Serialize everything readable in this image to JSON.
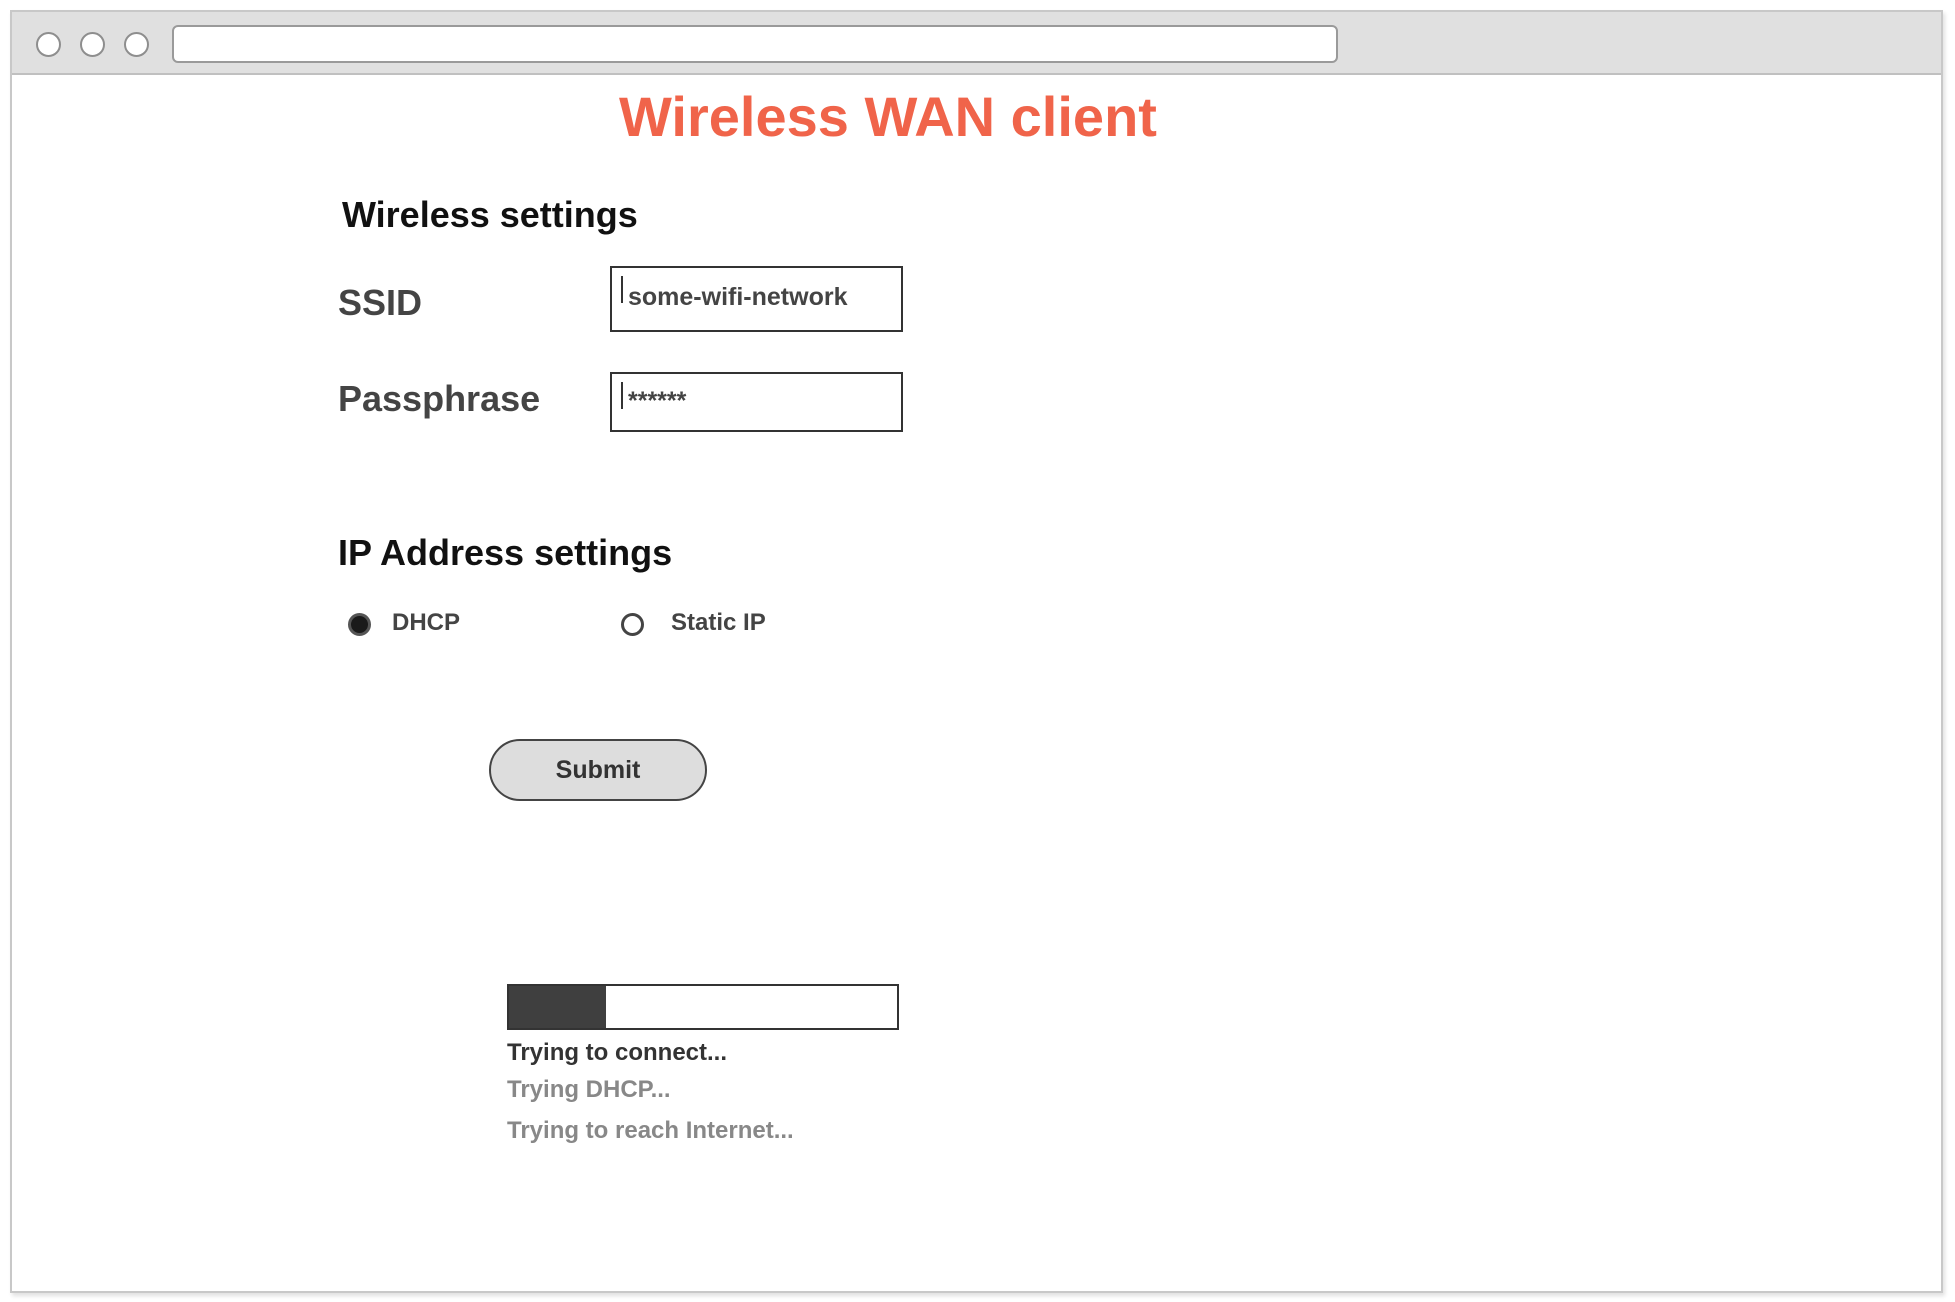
{
  "window": {
    "address_bar_value": ""
  },
  "page": {
    "title": "Wireless WAN client",
    "title_color": "#f0644a"
  },
  "wireless": {
    "heading": "Wireless settings",
    "ssid_label": "SSID",
    "ssid_value": "some-wifi-network",
    "passphrase_label": "Passphrase",
    "passphrase_value": "******"
  },
  "ip": {
    "heading": "IP Address settings",
    "options": [
      {
        "label": "DHCP",
        "selected": true
      },
      {
        "label": "Static IP",
        "selected": false
      }
    ]
  },
  "actions": {
    "submit_label": "Submit"
  },
  "progress": {
    "value_percent": 25,
    "fill_color": "#3f3f3f",
    "status": [
      {
        "text": "Trying to connect...",
        "state": "active"
      },
      {
        "text": "Trying DHCP...",
        "state": "pending"
      },
      {
        "text": "Trying to reach Internet...",
        "state": "pending"
      }
    ]
  }
}
